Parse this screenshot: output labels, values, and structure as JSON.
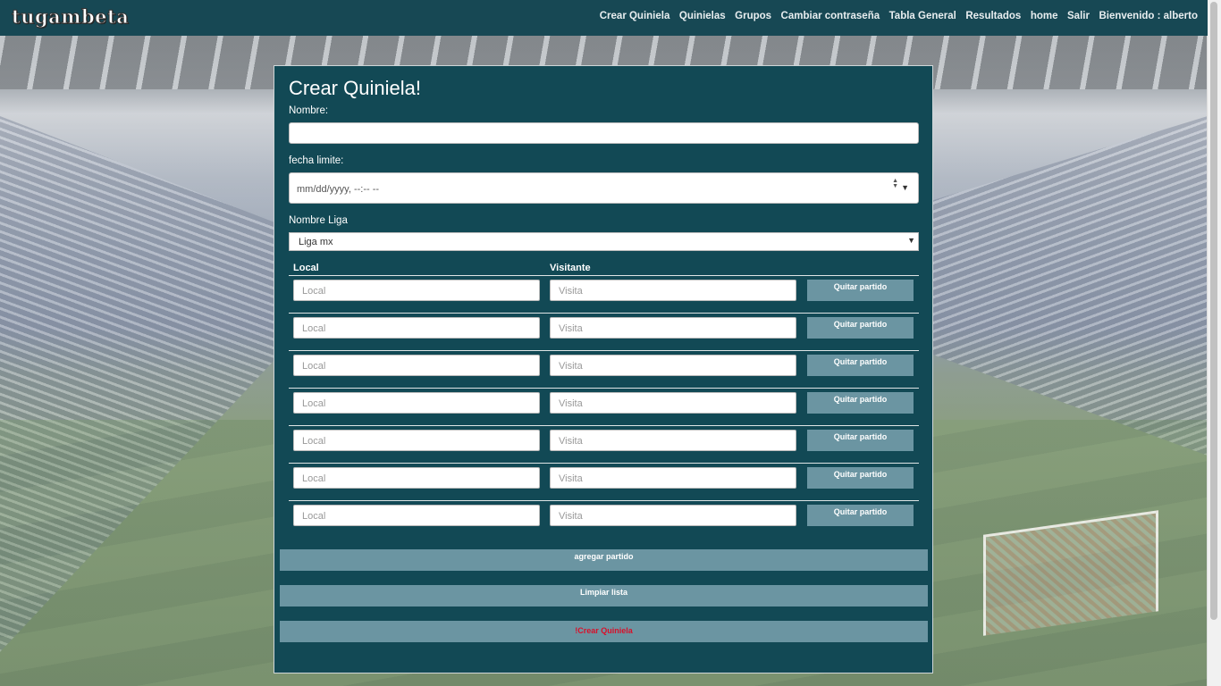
{
  "navbar": {
    "brand": "tugambeta",
    "links": [
      "Crear Quiniela",
      "Quinielas",
      "Grupos",
      "Cambiar contraseña",
      "Tabla General",
      "Resultados",
      "home",
      "Salir",
      "Bienvenido : alberto"
    ]
  },
  "form": {
    "title": "Crear Quiniela!",
    "nombre_label": "Nombre:",
    "nombre_value": "",
    "fecha_label": "fecha limite:",
    "fecha_placeholder": "mm/dd/yyyy, --:-- --",
    "liga_label": "Nombre Liga",
    "liga_selected": "Liga mx",
    "col_local": "Local",
    "col_visitante": "Visitante",
    "matches": [
      {
        "local_placeholder": "Local",
        "visita_placeholder": "Visita",
        "remove_label": "Quitar partido"
      },
      {
        "local_placeholder": "Local",
        "visita_placeholder": "Visita",
        "remove_label": "Quitar partido"
      },
      {
        "local_placeholder": "Local",
        "visita_placeholder": "Visita",
        "remove_label": "Quitar partido"
      },
      {
        "local_placeholder": "Local",
        "visita_placeholder": "Visita",
        "remove_label": "Quitar partido"
      },
      {
        "local_placeholder": "Local",
        "visita_placeholder": "Visita",
        "remove_label": "Quitar partido"
      },
      {
        "local_placeholder": "Local",
        "visita_placeholder": "Visita",
        "remove_label": "Quitar partido"
      },
      {
        "local_placeholder": "Local",
        "visita_placeholder": "Visita",
        "remove_label": "Quitar partido"
      }
    ],
    "add_match_label": "agregar partido",
    "clear_list_label": "Limpiar lista",
    "create_label": "!Crear Quiniela"
  },
  "colors": {
    "navbar_bg": "#174854",
    "card_bg": "#124955",
    "button_bg": "#6b95a2",
    "create_text": "#d8102a"
  }
}
